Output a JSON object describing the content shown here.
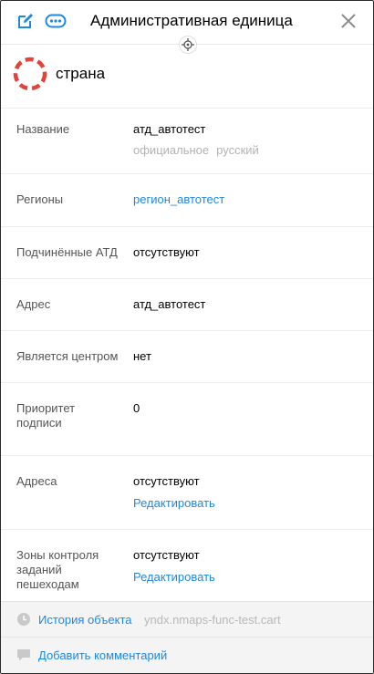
{
  "header": {
    "title": "Административная единица",
    "edit_icon": "edit-icon",
    "more_icon": "more-icon",
    "close_icon": "close-icon",
    "center_icon": "crosshair-icon"
  },
  "object_type": {
    "label": "страна",
    "icon": "dashed-circle-icon",
    "color": "#e0443a"
  },
  "attributes": {
    "name": {
      "label": "Название",
      "value": "атд_автотест",
      "lang_type": "официальное",
      "lang": "русский"
    },
    "regions": {
      "label": "Регионы",
      "value": "регион_автотест"
    },
    "subordinate": {
      "label": "Подчинённые АТД",
      "value": "отсутствуют"
    },
    "address": {
      "label": "Адрес",
      "value": "атд_автотест"
    },
    "is_center": {
      "label": "Является центром",
      "value": "нет"
    },
    "signature_priority": {
      "label": "Приоритет подписи",
      "value": "0"
    },
    "addresses": {
      "label": "Адреса",
      "value": "отсутствуют",
      "action": "Редактировать"
    },
    "pedestrian_zones": {
      "label": "Зоны контроля заданий пешеходам",
      "value": "отсутствуют",
      "action": "Редактировать"
    }
  },
  "footer": {
    "history_label": "История объекта",
    "history_author": "yndx.nmaps-func-test.cart",
    "comment_label": "Добавить комментарий",
    "history_icon": "clock-icon",
    "comment_icon": "comment-icon"
  },
  "colors": {
    "accent": "#1e88e5",
    "brand_red": "#e0443a"
  }
}
